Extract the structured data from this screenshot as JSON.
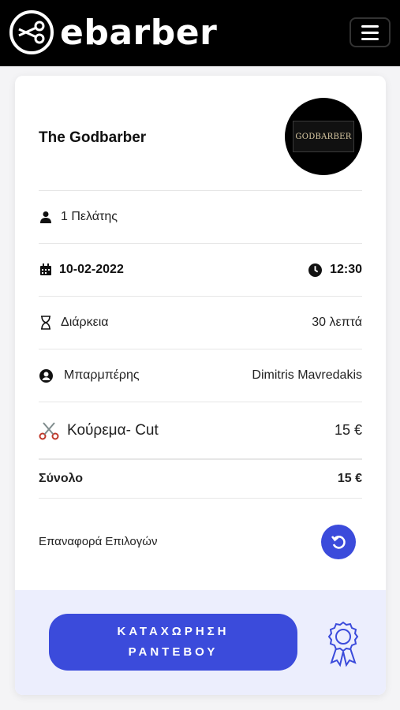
{
  "header": {
    "brand": "ebarber",
    "menu_icon": "hamburger-icon"
  },
  "shop": {
    "name": "The Godbarber",
    "avatar_text": "GODBARBER"
  },
  "booking": {
    "clients": "1 Πελάτης",
    "date": "10-02-2022",
    "time": "12:30",
    "duration_label": "Διάρκεια",
    "duration_value": "30 λεπτά",
    "barber_label": "Μπαρμπέρης",
    "barber_value": "Dimitris Mavredakis",
    "service_name": "Κούρεμα- Cut",
    "service_price": "15 €",
    "total_label": "Σύνολο",
    "total_value": "15 €",
    "reset_label": "Επαναφορά Επιλογών"
  },
  "footer": {
    "cta_label": "ΚΑΤΑΧΩΡΗΣΗ ΡΑΝΤΕΒΟΥ"
  },
  "colors": {
    "accent": "#3b4bdb",
    "footer_bg": "#eceefd",
    "header_bg": "#000000",
    "scissors": "#c0392b"
  }
}
